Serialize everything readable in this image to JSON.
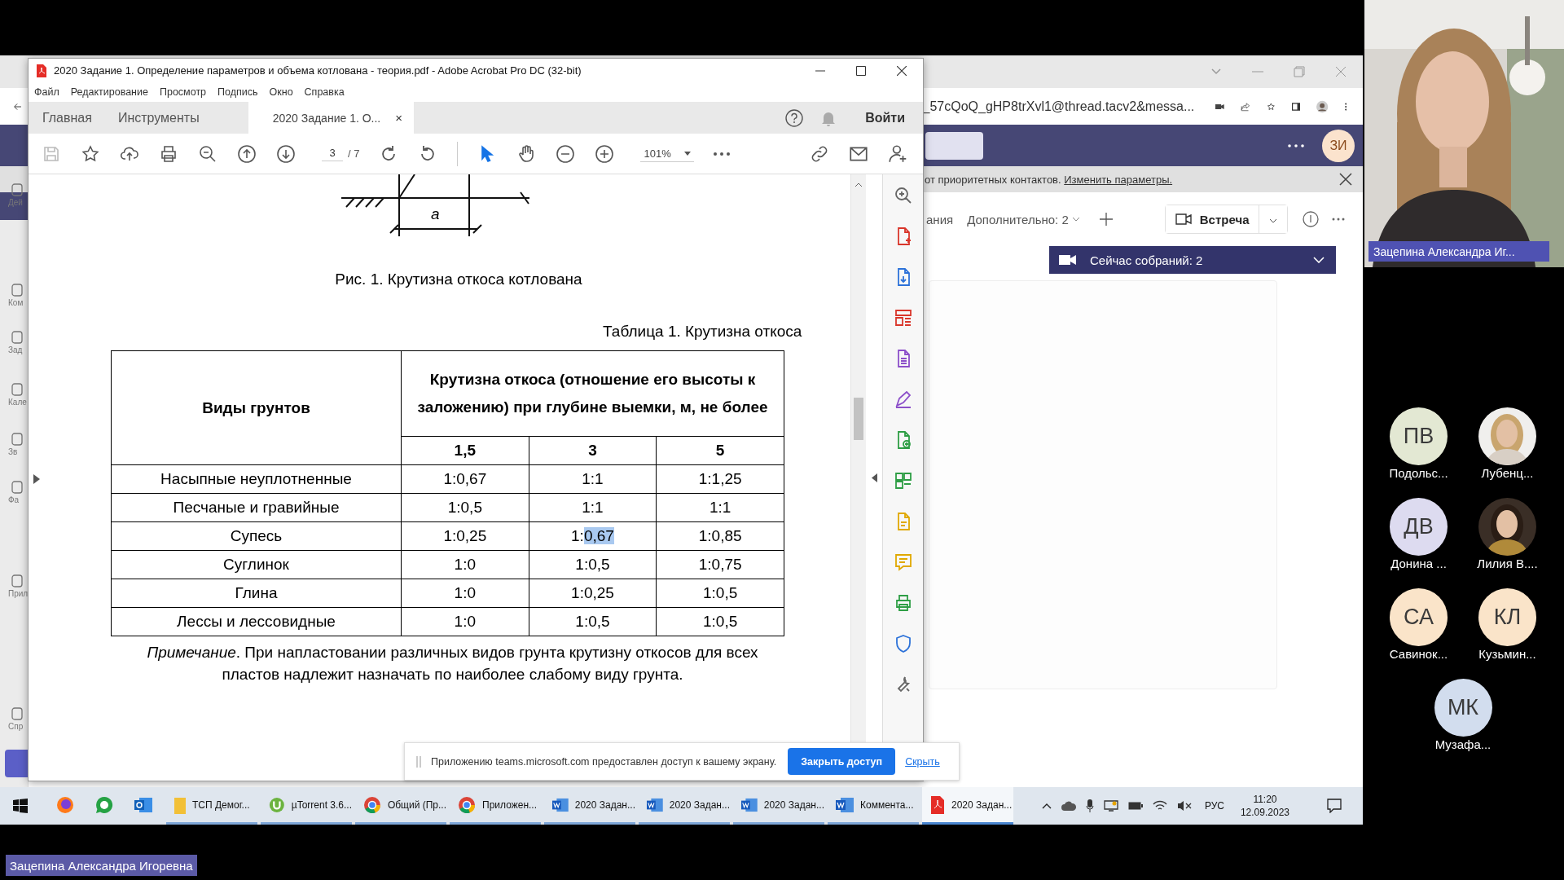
{
  "screen_share": {
    "browser": {
      "address": "_57cQoQ_gHP8trXvl1@thread.tacv2&messa...",
      "avatar_initials": "ЗИ",
      "notice": {
        "text": "от приоритетных контактов.",
        "link": "Изменить параметры."
      },
      "rail_labels": [
        "Дей",
        "Ком",
        "Зад",
        "Кале",
        "Зв",
        "Фа",
        "Прил",
        "Спр"
      ],
      "tab_fragment": "ания",
      "more_tabs": "Дополнительно: 2",
      "meet_button": "Встреча",
      "meetings_bar": "Сейчас собраний: 2"
    },
    "acrobat": {
      "title": "2020 Задание 1. Определение параметров и объема котлована - теория.pdf - Adobe Acrobat Pro DC (32-bit)",
      "menu": [
        "Файл",
        "Редактирование",
        "Просмотр",
        "Подпись",
        "Окно",
        "Справка"
      ],
      "tabs": [
        {
          "label": "Главная",
          "selected": false
        },
        {
          "label": "Инструменты",
          "selected": false
        },
        {
          "label": "2020 Задание 1. О...",
          "selected": true,
          "close": "×"
        }
      ],
      "sign_in": "Войти",
      "page_current": "3",
      "page_total": "/ 7",
      "zoom": "101%",
      "document": {
        "figure_label": "a",
        "figure_caption": "Рис. 1. Крутизна откоса котлована",
        "table_caption": "Таблица 1. Крутизна откоса",
        "table": {
          "corner": "Виды грунтов",
          "group_header": "Крутизна откоса (отношение его высоты к заложению) при глубине выемки, м, не более",
          "columns": [
            "",
            "1,5",
            "3",
            "5"
          ],
          "rows": [
            [
              "Насыпные неуплотненные",
              "1:0,67",
              "1:1",
              "1:1,25"
            ],
            [
              "Песчаные и гравийные",
              "1:0,5",
              "1:1",
              "1:1"
            ],
            [
              "Супесь",
              "1:0,25",
              {
                "text": "1:",
                "highlighted": "0,67"
              },
              "1:0,85"
            ],
            [
              "Суглинок",
              "1:0",
              "1:0,5",
              "1:0,75"
            ],
            [
              "Глина",
              "1:0",
              "1:0,25",
              "1:0,5"
            ],
            [
              "Лессы и лессовидные",
              "1:0",
              "1:0,5",
              "1:0,5"
            ]
          ]
        },
        "note": "*Примечание*. При напластовании различных видов грунта крутизну откосов для всех пластов надлежит назначать по наиболее слабому виду грунта."
      }
    },
    "share_banner": {
      "text": "Приложению teams.microsoft.com предоставлен доступ к вашему экрану.",
      "stop_button": "Закрыть доступ",
      "hide_link": "Скрыть"
    },
    "taskbar": {
      "items": [
        {
          "kind": "globe",
          "selected": false
        },
        {
          "kind": "chat",
          "selected": false
        },
        {
          "kind": "mail",
          "selected": false
        },
        {
          "kind": "folder",
          "label": "ТСП Демог...",
          "selected": false
        },
        {
          "kind": "torrent",
          "label": "µTorrent 3.6...",
          "selected": false
        },
        {
          "kind": "ring",
          "label": "Общий (Пр...",
          "selected": false
        },
        {
          "kind": "ring",
          "label": "Приложен...",
          "selected": false
        },
        {
          "kind": "word",
          "label": "2020 Задан...",
          "selected": false
        },
        {
          "kind": "word",
          "label": "2020 Задан...",
          "selected": false
        },
        {
          "kind": "word",
          "label": "2020 Задан...",
          "selected": false
        },
        {
          "kind": "word",
          "label": "Коммента...",
          "selected": false
        },
        {
          "kind": "pdf",
          "label": "2020 Задан...",
          "selected": true
        }
      ],
      "language": "РУС",
      "time": "11:20",
      "date": "12.09.2023"
    }
  },
  "presenter": {
    "name": "Зацепина Александра Иг..."
  },
  "participants": [
    {
      "kind": "initials",
      "initials": "ПВ",
      "color": "#e3e8d3",
      "name": "Подольс..."
    },
    {
      "name": "Лубенц..."
    },
    {
      "kind": "initials",
      "initials": "ДВ",
      "color": "#dddbf0",
      "name": "Донина ..."
    },
    {
      "name": "Лилия В...."
    },
    {
      "kind": "initials",
      "initials": "СА",
      "color": "#fae4c9",
      "name": "Савинок..."
    },
    {
      "kind": "initials",
      "initials": "КЛ",
      "color": "#fae4c9",
      "name": "Кузьмин..."
    },
    {
      "kind": "initials",
      "initials": "МК",
      "color": "#d2ddee",
      "name": "Музафа..."
    }
  ],
  "speaker_label": "Зацепина Александра Игоревна"
}
